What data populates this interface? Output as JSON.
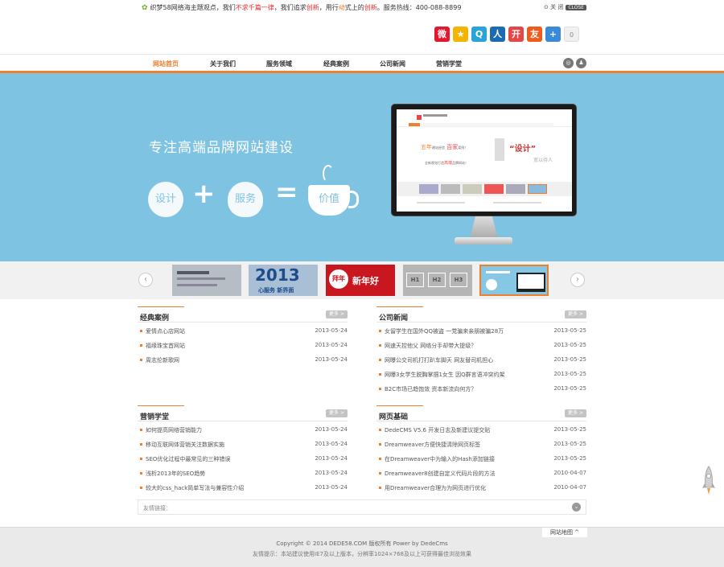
{
  "topbar": {
    "slogan_1": "织梦58网络海主题观点，我们",
    "slogan_red": "不求千篇一律",
    "slogan_2": "，我们追求",
    "slogan_red2": "创新",
    "slogan_3": "，用行",
    "slogan_org": "动",
    "slogan_4": "式上的",
    "slogan_red3": "创新",
    "slogan_5": "。服务热线：400-088-8899",
    "links": "⊙ 关 闭",
    "tag": "CLOSE"
  },
  "share": [
    {
      "icon": "weibo-icon",
      "glyph": "微",
      "color": "#e6162d"
    },
    {
      "icon": "qzone-icon",
      "glyph": "★",
      "color": "#f4b400"
    },
    {
      "icon": "tqq-icon",
      "glyph": "Q",
      "color": "#2aa3d8"
    },
    {
      "icon": "renren-icon",
      "glyph": "人",
      "color": "#1a6bb3"
    },
    {
      "icon": "kaixin-icon",
      "glyph": "开",
      "color": "#e34747"
    },
    {
      "icon": "pengyou-icon",
      "glyph": "友",
      "color": "#f25a1d"
    },
    {
      "icon": "more-share-icon",
      "glyph": "+",
      "color": "#3b8ad9"
    },
    {
      "icon": "count-icon",
      "glyph": "0",
      "color": "#f0f0f0"
    }
  ],
  "nav": {
    "items": [
      "网站首页",
      "关于我们",
      "服务领域",
      "经典案例",
      "公司新闻",
      "营销学堂"
    ]
  },
  "banner": {
    "title": "专注高端品牌网站建设",
    "w1": "设计",
    "w2": "服务",
    "w3": "价值",
    "screen_a": "五年",
    "screen_b": "建站经验",
    "screen_c": "百家",
    "screen_d": "案例！",
    "screen_e": "“设计”",
    "screen_f": "宽以待人",
    "screen_g": "全新视觉打造",
    "screen_h": "高端",
    "screen_i": "品牌网站！"
  },
  "thumbs": [
    "2013",
    "心服务 新界面",
    "拜年",
    "新年好",
    "H1",
    "H2",
    "H3"
  ],
  "sections": {
    "cases": {
      "title": "经典案例",
      "more": "更多 >",
      "items": [
        {
          "t": "爱情点心店网站",
          "d": "2013-05-24"
        },
        {
          "t": "福缘珠宝首网站",
          "d": "2013-05-24"
        },
        {
          "t": "周志伦新歌网",
          "d": "2013-05-24"
        }
      ]
    },
    "news": {
      "title": "公司新闻",
      "more": "更多 >",
      "items": [
        {
          "t": "女留学生在国外QQ被盗 一党骗来亲朋被骗28万",
          "d": "2013-05-25"
        },
        {
          "t": "网速天控他父 网络分手却带大提级？",
          "d": "2013-05-25"
        },
        {
          "t": "网曝公交司机打打趴车脚天 网友替司机担心",
          "d": "2013-05-25"
        },
        {
          "t": "网曝3女学生脱胸掌掴1女生 因Q群言语冲突约架",
          "d": "2013-05-25"
        },
        {
          "t": "B2C市场已趋饱敛 资本新流向何方？",
          "d": "2013-05-25"
        }
      ]
    },
    "marketing": {
      "title": "营销学堂",
      "more": "更多 >",
      "items": [
        {
          "t": "如何提高网络营销能力",
          "d": "2013-05-24"
        },
        {
          "t": "移动互联网体营销关注数据实施",
          "d": "2013-05-24"
        },
        {
          "t": "SEO优化过程中最常见的三种错误",
          "d": "2013-05-24"
        },
        {
          "t": "浅析2013年的SEO趋势",
          "d": "2013-05-24"
        },
        {
          "t": "较大的css_hack简单写法与兼容性介绍",
          "d": "2013-05-24"
        }
      ]
    },
    "web": {
      "title": "网页基础",
      "more": "更多 >",
      "items": [
        {
          "t": "DedeCMS V5.6 开发日志及新建议提交贴",
          "d": "2013-05-25"
        },
        {
          "t": "Dreamweaver方便快捷清除网页标签",
          "d": "2013-05-25"
        },
        {
          "t": "在Dreamweaver中为输入的Hash添加链接",
          "d": "2013-05-25"
        },
        {
          "t": "Dreamweaver8创建自定义代码片段的方法",
          "d": "2010-04-07"
        },
        {
          "t": "用Dreamweaver合理为为网页进行优化",
          "d": "2010-04-07"
        }
      ]
    }
  },
  "friends": {
    "label": "友情链接：",
    "toggle": "⌄"
  },
  "footer": {
    "sitemap": "网站地图 ^",
    "copyright": "Copyright © 2014 DEDE58.COM 版权所有 Power by DedeCms",
    "tip": "友情提示：本站建议使用IE7及以上版本，分辨率1024×768及以上可获得最佳浏览效果"
  },
  "colors": {
    "accent": "#ee7f2d",
    "banner": "#7ec3e2"
  }
}
